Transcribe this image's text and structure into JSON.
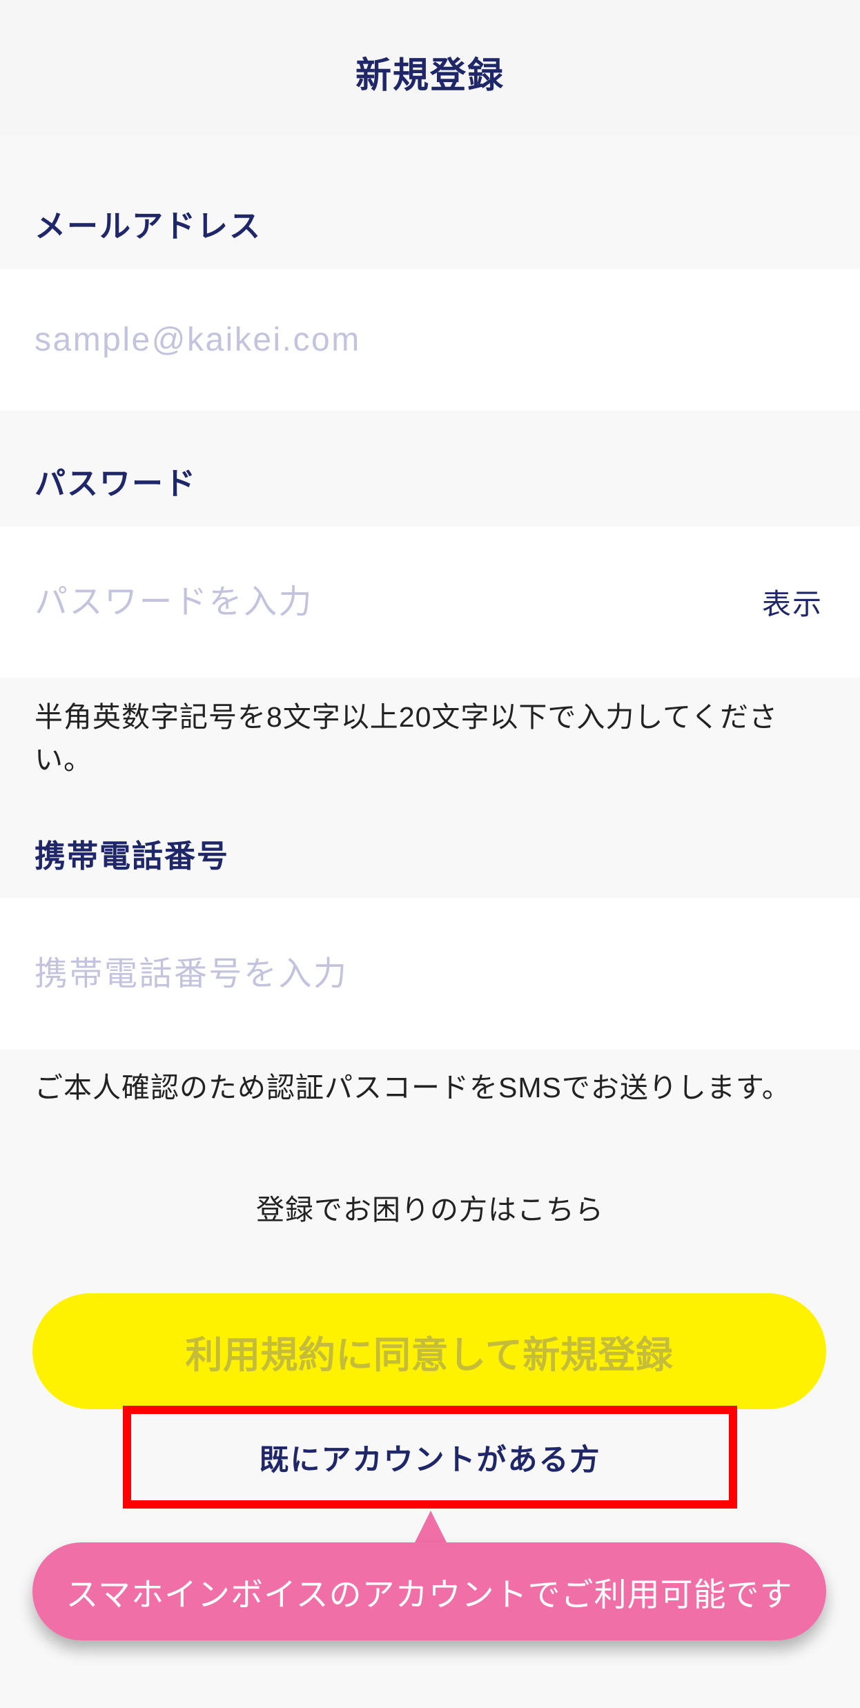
{
  "header": {
    "title": "新規登録"
  },
  "form": {
    "email": {
      "label": "メールアドレス",
      "placeholder": "sample@kaikei.com",
      "value": ""
    },
    "password": {
      "label": "パスワード",
      "placeholder": "パスワードを入力",
      "value": "",
      "toggle_label": "表示",
      "hint": "半角英数字記号を8文字以上20文字以下で入力してください。"
    },
    "phone": {
      "label": "携帯電話番号",
      "placeholder": "携帯電話番号を入力",
      "value": "",
      "hint": "ご本人確認のため認証パスコードをSMSでお送りします。"
    }
  },
  "help_link": {
    "label": "登録でお困りの方はこちら"
  },
  "submit_button": {
    "label": "利用規約に同意して新規登録",
    "enabled": false
  },
  "login_link": {
    "label": "既にアカウントがある方",
    "highlighted": true
  },
  "tooltip": {
    "text": "スマホインボイスのアカウントでご利用可能です"
  },
  "colors": {
    "background": "#f8f8f8",
    "header_background": "#f6f6f6",
    "primary_text": "#1f2769",
    "placeholder": "#c4c3dd",
    "body_text": "#222222",
    "field_background": "#ffffff",
    "button_yellow": "#fff200",
    "button_text_disabled": "#c5bd3a",
    "highlight_red": "#ff0000",
    "tooltip_pink": "#ef6fa6"
  }
}
